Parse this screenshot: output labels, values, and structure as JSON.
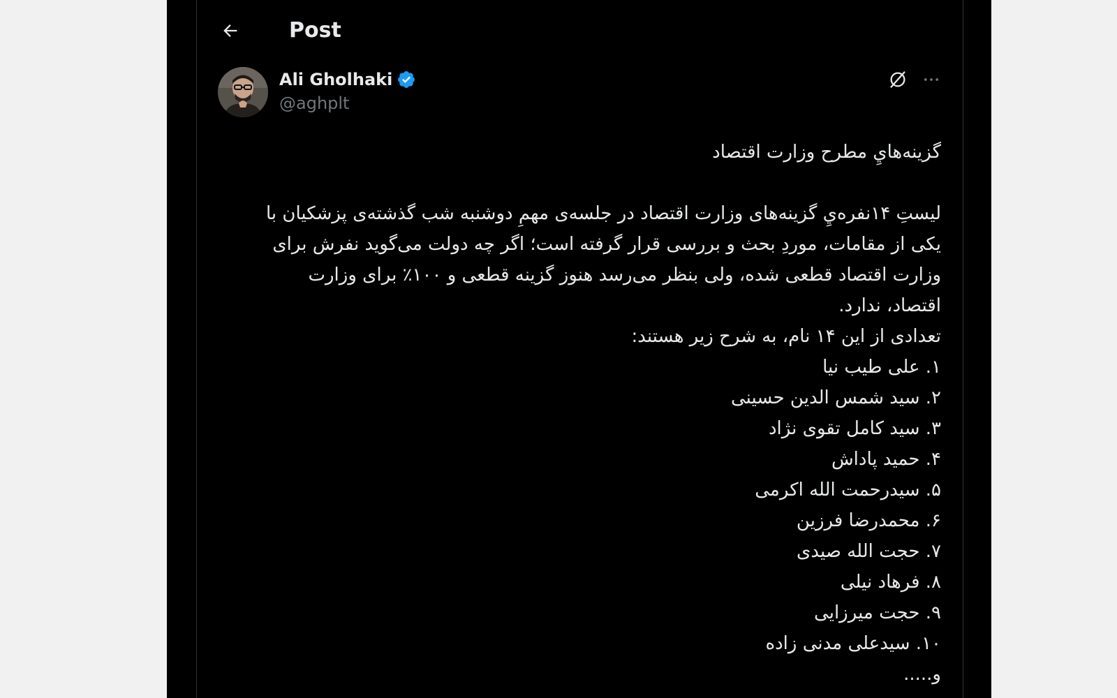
{
  "header": {
    "title": "Post",
    "back_icon": "arrow-left-icon"
  },
  "author": {
    "display_name": "Ali Gholhaki",
    "handle": "@aghplt",
    "verified_color": "#1d9bf0"
  },
  "actions": {
    "grok_icon": "grok-icon",
    "more_icon": "more-horizontal-icon"
  },
  "post": {
    "title": "گزینه‌هايِ مطرح وزارت اقتصاد",
    "paragraph": "لیستِ ۱۴نفره‌يِ گزینه‌های وزارت اقتصاد در جلسه‌ی مهمِ دوشنبه شب گذشته‌ی پزشکیان با یکی از مقامات، موردِ بحث و بررسی قرار گرفته است؛ اگر چه دولت می‌گوید نفرش برای وزارت اقتصاد قطعی شده، ولی بنظر می‌رسد هنوز گزینه قطعی و ۱۰۰٪ برای وزارت اقتصاد، ندارد.",
    "intro": "تعدادی از این ۱۴ نام، به شرح زیر هستند:",
    "items": [
      "۱. علی طیب نیا",
      "۲. سید شمس الدین حسینی",
      "۳. سید کامل تقوی نژاد",
      "۴. حمید پاداش",
      "۵. سیدرحمت الله اکرمی",
      "۶. محمدرضا فرزین",
      "۷. حجت الله صیدی",
      "۸. فرهاد نیلی",
      "۹. حجت میرزایی",
      "۱۰. سیدعلی مدنی زاده"
    ],
    "ellipsis": "و....."
  }
}
